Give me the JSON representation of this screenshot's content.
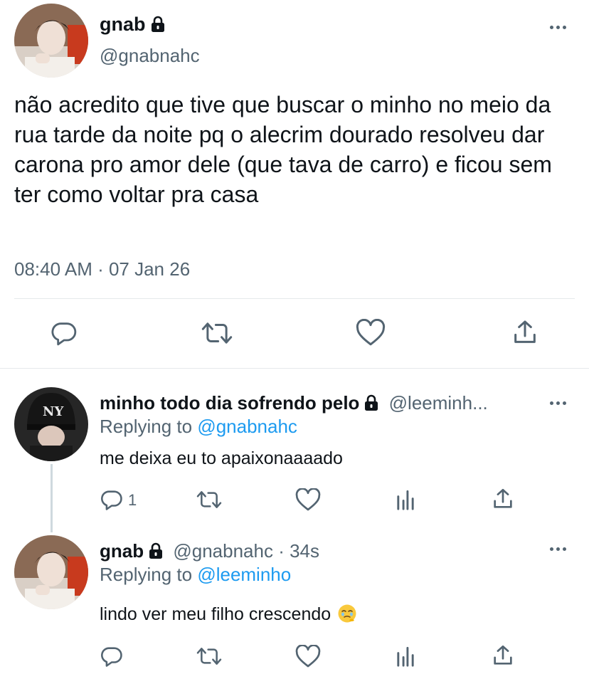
{
  "main_tweet": {
    "display_name": "gnab",
    "handle": "@gnabnahc",
    "text": "não acredito que tive que buscar o minho no meio da rua tarde da noite pq o alecrim dourado resolveu dar carona pro amor dele (que tava de carro) e ficou sem ter como voltar pra casa",
    "timestamp": "08:40 AM · 07 Jan 26",
    "actions": [
      "reply-icon",
      "retweet-icon",
      "like-icon",
      "share-icon"
    ]
  },
  "replies": [
    {
      "display_name": "minho todo dia sofrendo pelo",
      "handle": "@leeminh...",
      "replying_label": "Replying to",
      "replying_to": "@gnabnahc",
      "text": "me deixa eu to apaixonaaaado",
      "reply_count": "1",
      "actions": [
        "reply-icon",
        "retweet-icon",
        "like-icon",
        "analytics-icon",
        "share-icon"
      ]
    },
    {
      "display_name": "gnab",
      "handle": "@gnabnahc",
      "time": "· 34s",
      "replying_label": "Replying to",
      "replying_to": "@leeminho",
      "text": "lindo ver meu filho crescendo",
      "emoji": "face-holding-back-tears-emoji",
      "actions": [
        "reply-icon",
        "retweet-icon",
        "like-icon",
        "analytics-icon",
        "share-icon"
      ]
    }
  ],
  "colors": {
    "text": "#0f1419",
    "secondary": "#536471",
    "link": "#1d9bf0",
    "divider": "#e6e9eb"
  }
}
